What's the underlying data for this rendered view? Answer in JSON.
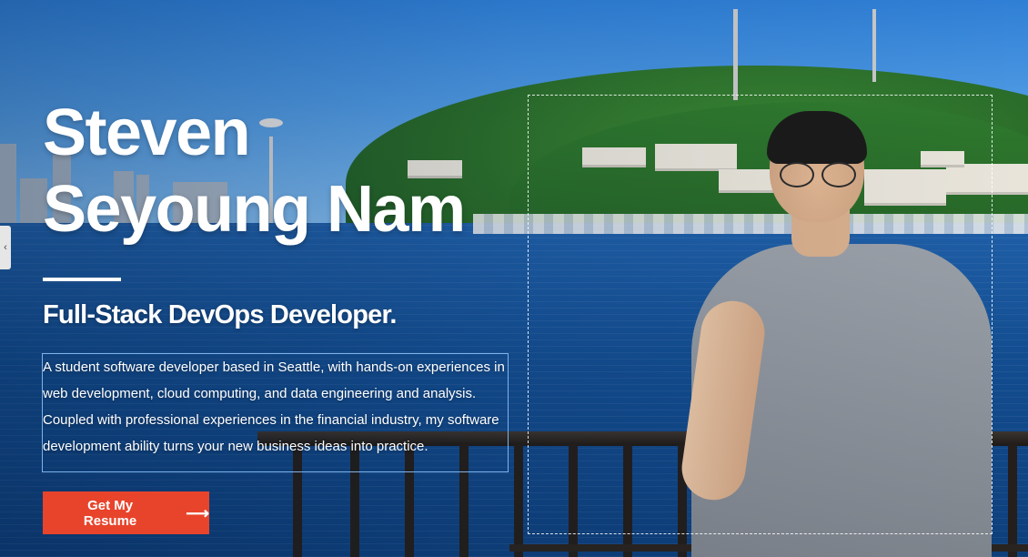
{
  "hero": {
    "name_line1": "Steven",
    "name_line2": "Seyoung Nam",
    "role": "Full-Stack DevOps Developer.",
    "bio": "A student software developer based in Seattle, with hands-on experiences in web development, cloud computing, and data engineering and analysis. Coupled with professional experiences in the financial industry, my software development ability turns your new business ideas into practice.",
    "cta_label": "Get My Resume",
    "cta_icon": "arrow-right-icon"
  },
  "side_tab": {
    "icon": "chevron-left-icon"
  },
  "colors": {
    "cta_background": "#e8442b",
    "text": "#ffffff",
    "bio_outline": "#7db4ec"
  }
}
